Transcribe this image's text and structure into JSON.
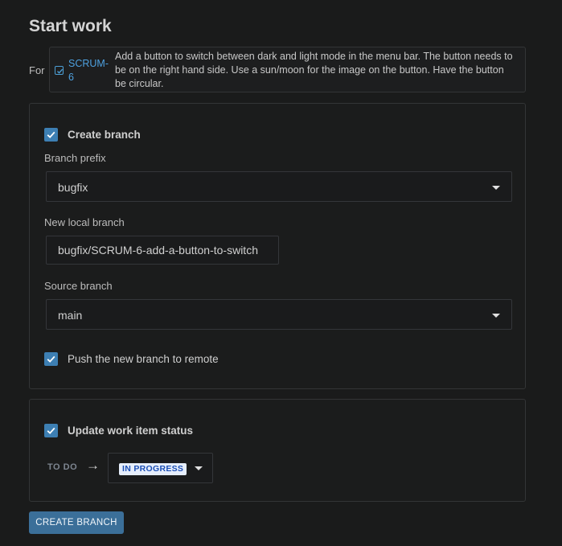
{
  "page": {
    "title": "Start work"
  },
  "issue": {
    "for_label": "For",
    "key": "SCRUM-6",
    "summary": "Add a button to switch between dark and light mode in the menu bar. The button needs to be on the right hand side. Use a sun/moon for the image on the button. Have the button be circular."
  },
  "branch_section": {
    "create_branch": {
      "label": "Create branch",
      "checked": true
    },
    "branch_prefix": {
      "label": "Branch prefix",
      "value": "bugfix"
    },
    "new_local_branch": {
      "label": "New local branch",
      "value": "bugfix/SCRUM-6-add-a-button-to-switch"
    },
    "source_branch": {
      "label": "Source branch",
      "value": "main"
    },
    "push_remote": {
      "label": "Push the new branch to remote",
      "checked": true
    }
  },
  "status_section": {
    "update_status": {
      "label": "Update work item status",
      "checked": true
    },
    "from_status": "TO DO",
    "arrow": "→",
    "to_status": "IN PROGRESS"
  },
  "actions": {
    "create_branch_button": "CREATE BRANCH"
  },
  "colors": {
    "background": "#1a1b1b",
    "accent_checkbox": "#3d7fb3",
    "primary_button": "#3b6f99",
    "issue_key": "#4ea1e0",
    "lozenge_bg": "#e6eefc",
    "lozenge_text": "#1c4fb5"
  }
}
